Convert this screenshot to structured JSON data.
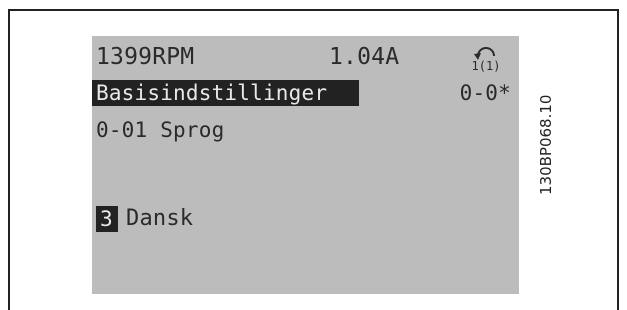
{
  "display": {
    "speed": "1399RPM",
    "current": "1.04A",
    "setup_icon": "setup-1-1-icon",
    "setup_icon_label": "1(1)",
    "group_title": "Basisindstillinger",
    "group_code": "0-0*",
    "parameter": "0-01 Sprog",
    "value_index": "3",
    "value": "Dansk"
  },
  "figure_code": "130BP068.10",
  "colors": {
    "lcd_background": "#bcbcbc",
    "lcd_text": "#2a2a2a",
    "highlight": "#222222"
  }
}
